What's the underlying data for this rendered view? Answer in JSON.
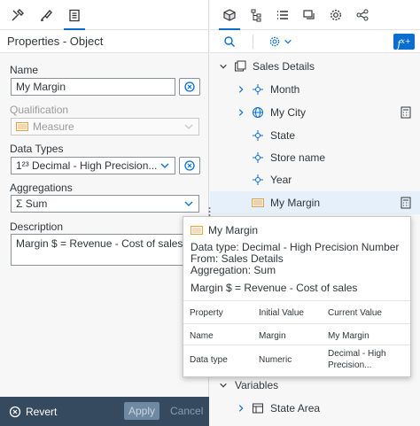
{
  "left_panel": {
    "title": "Properties - Object",
    "name_label": "Name",
    "name_value": "My Margin",
    "qualification_label": "Qualification",
    "qualification_value": "Measure",
    "data_types_label": "Data Types",
    "data_type_value": "1²³ Decimal - High Precision...",
    "aggregations_label": "Aggregations",
    "aggregation_value": "Σ Sum",
    "description_label": "Description",
    "description_value": "Margin $ = Revenue - Cost of sales",
    "revert_label": "Revert",
    "apply_label": "Apply",
    "cancel_label": "Cancel"
  },
  "tree": {
    "root": "Sales Details",
    "items": [
      {
        "label": "Month",
        "expandable": true,
        "icon": "hierarchy-icon"
      },
      {
        "label": "My City",
        "expandable": true,
        "icon": "globe-icon"
      },
      {
        "label": "State",
        "expandable": false,
        "icon": "dimension-icon"
      },
      {
        "label": "Store name",
        "expandable": false,
        "icon": "dimension-icon"
      },
      {
        "label": "Year",
        "expandable": false,
        "icon": "dimension-icon"
      },
      {
        "label": "My Margin",
        "expandable": false,
        "icon": "measure-icon"
      }
    ],
    "variables_label": "Variables",
    "state_area_label": "State Area"
  },
  "tooltip": {
    "title": "My Margin",
    "data_type": "Data type:  Decimal - High Precision Number",
    "from": "From:  Sales Details",
    "aggregation": "Aggregation:  Sum",
    "formula": "Margin $ = Revenue - Cost of sales",
    "headers": [
      "Property",
      "Initial Value",
      "Current Value"
    ],
    "rows": [
      {
        "property": "Name",
        "initial": "Margin",
        "current": "My Margin"
      },
      {
        "property": "Data type",
        "initial": "Numeric",
        "current_1": "Decimal - High",
        "current_2": "Precision..."
      }
    ]
  },
  "colors": {
    "accent": "#0a6ed1",
    "footer": "#354a5f",
    "measure": "#e9a13b"
  }
}
